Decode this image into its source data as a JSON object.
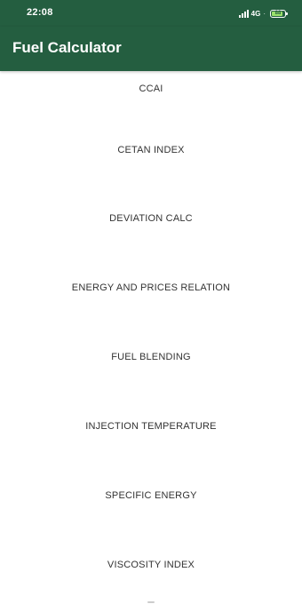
{
  "status_bar": {
    "time": "22:08",
    "network": "4G",
    "separator": "·",
    "battery_text": "88",
    "battery_level": 0.88,
    "battery_color": "#9be26b",
    "bar_color": "#245e40"
  },
  "app_bar": {
    "title": "Fuel Calculator",
    "color": "#245e40"
  },
  "menu": {
    "items": [
      {
        "label": "CCAI"
      },
      {
        "label": "CETAN INDEX"
      },
      {
        "label": "DEVIATION CALC"
      },
      {
        "label": "ENERGY AND PRICES RELATION"
      },
      {
        "label": "FUEL BLENDING"
      },
      {
        "label": "INJECTION TEMPERATURE"
      },
      {
        "label": "SPECIFIC ENERGY"
      },
      {
        "label": "VISCOSITY INDEX"
      }
    ]
  }
}
